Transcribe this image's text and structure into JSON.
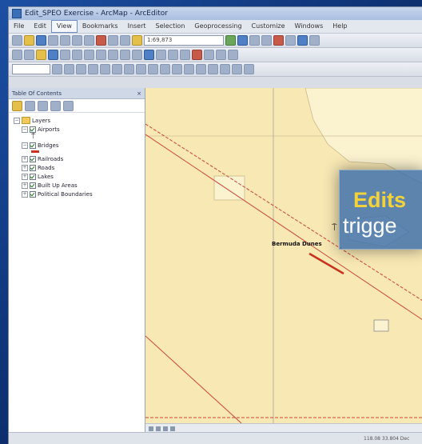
{
  "window": {
    "title": "Edit_SPEO Exercise - ArcMap - ArcEditor"
  },
  "menu": {
    "items": [
      "File",
      "Edit",
      "View",
      "Bookmarks",
      "Insert",
      "Selection",
      "Geoprocessing",
      "Customize",
      "Windows",
      "Help"
    ],
    "active_index": 2
  },
  "toolbar": {
    "scale_value": "1:69,873"
  },
  "toc": {
    "title": "Table Of Contents",
    "root_label": "Layers",
    "layers": [
      {
        "label": "Airports",
        "symbol": "airport-symbol"
      },
      {
        "label": "Bridges",
        "symbol": "bridge-line-symbol"
      },
      {
        "label": "Railroads"
      },
      {
        "label": "Roads"
      },
      {
        "label": "Lakes"
      },
      {
        "label": "Built Up Areas"
      },
      {
        "label": "Political Boundaries"
      }
    ]
  },
  "map": {
    "feature_label": "Bermuda Dunes"
  },
  "callout": {
    "line1": "Edits",
    "line2": "trigge"
  },
  "statusbar": {
    "coords": "118.08  33.804 Dec"
  },
  "colors": {
    "background": "#0d2f6b",
    "map_fill": "#f8e8b4",
    "callout_bg": "#3a6eaa",
    "callout_accent": "#f4d33a",
    "rail_line": "#c9473a"
  }
}
